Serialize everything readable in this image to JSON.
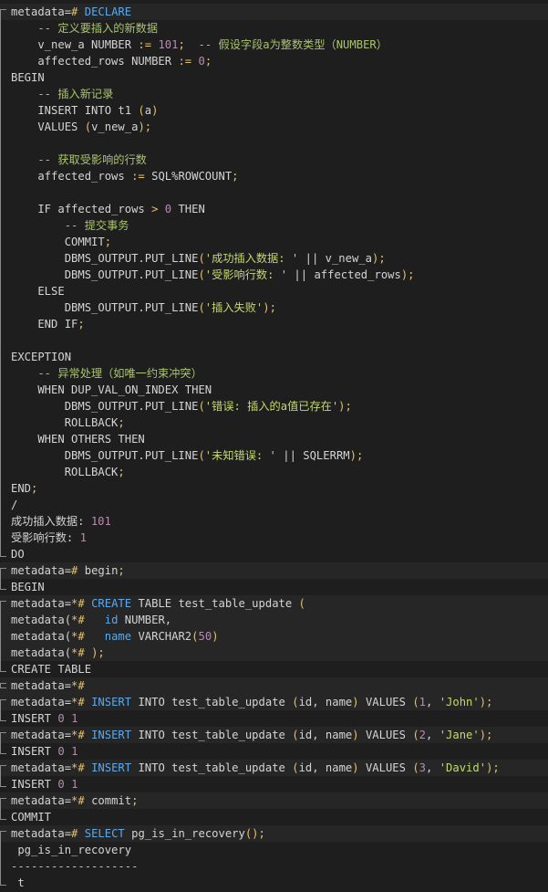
{
  "colors": {
    "background": "#1e1e1e",
    "highlight": "#262626",
    "text": "#d4d4d4",
    "number": "#b48ead",
    "string": "#c3d96d",
    "comment": "#a9c46b",
    "operator": "#e6c06a",
    "keyword": "#5fa8e8"
  },
  "lines": [
    {
      "hl": true,
      "segs": [
        [
          "plain",
          "metadata="
        ],
        [
          "op",
          "#"
        ],
        [
          "plain",
          " "
        ],
        [
          "kw2",
          "DECLARE"
        ]
      ]
    },
    {
      "segs": [
        [
          "com",
          "    -- 定义要插入的新数据"
        ]
      ]
    },
    {
      "segs": [
        [
          "plain",
          "    v_new_a NUMBER "
        ],
        [
          "op",
          ":="
        ],
        [
          "plain",
          " "
        ],
        [
          "num",
          "101"
        ],
        [
          "op",
          ";"
        ],
        [
          "plain",
          "  "
        ],
        [
          "com",
          "-- 假设字段a为整数类型（NUMBER）"
        ]
      ]
    },
    {
      "segs": [
        [
          "plain",
          "    affected_rows NUMBER "
        ],
        [
          "op",
          ":="
        ],
        [
          "plain",
          " "
        ],
        [
          "num",
          "0"
        ],
        [
          "op",
          ";"
        ]
      ]
    },
    {
      "segs": [
        [
          "plain",
          "BEGIN"
        ]
      ]
    },
    {
      "segs": [
        [
          "com",
          "    -- 插入新记录"
        ]
      ]
    },
    {
      "segs": [
        [
          "plain",
          "    INSERT INTO t1 "
        ],
        [
          "op",
          "("
        ],
        [
          "plain",
          "a"
        ],
        [
          "op",
          ")"
        ]
      ]
    },
    {
      "segs": [
        [
          "plain",
          "    VALUES "
        ],
        [
          "op",
          "("
        ],
        [
          "plain",
          "v_new_a"
        ],
        [
          "op",
          ");"
        ]
      ]
    },
    {
      "segs": [
        [
          "plain",
          ""
        ]
      ]
    },
    {
      "segs": [
        [
          "com",
          "    -- 获取受影响的行数"
        ]
      ]
    },
    {
      "segs": [
        [
          "plain",
          "    affected_rows "
        ],
        [
          "op",
          ":="
        ],
        [
          "plain",
          " SQL%ROWCOUNT"
        ],
        [
          "op",
          ";"
        ]
      ]
    },
    {
      "segs": [
        [
          "plain",
          ""
        ]
      ]
    },
    {
      "segs": [
        [
          "plain",
          "    IF affected_rows "
        ],
        [
          "op",
          ">"
        ],
        [
          "plain",
          " "
        ],
        [
          "num",
          "0"
        ],
        [
          "plain",
          " THEN"
        ]
      ]
    },
    {
      "segs": [
        [
          "com",
          "        -- 提交事务"
        ]
      ]
    },
    {
      "segs": [
        [
          "plain",
          "        COMMIT"
        ],
        [
          "op",
          ";"
        ]
      ]
    },
    {
      "segs": [
        [
          "plain",
          "        DBMS_OUTPUT.PUT_LINE"
        ],
        [
          "op",
          "("
        ],
        [
          "str",
          "'成功插入数据: '"
        ],
        [
          "plain",
          " || v_new_a"
        ],
        [
          "op",
          ");"
        ]
      ]
    },
    {
      "segs": [
        [
          "plain",
          "        DBMS_OUTPUT.PUT_LINE"
        ],
        [
          "op",
          "("
        ],
        [
          "str",
          "'受影响行数: '"
        ],
        [
          "plain",
          " || affected_rows"
        ],
        [
          "op",
          ");"
        ]
      ]
    },
    {
      "segs": [
        [
          "plain",
          "    ELSE"
        ]
      ]
    },
    {
      "segs": [
        [
          "plain",
          "        DBMS_OUTPUT.PUT_LINE"
        ],
        [
          "op",
          "("
        ],
        [
          "str",
          "'插入失败'"
        ],
        [
          "op",
          ");"
        ]
      ]
    },
    {
      "segs": [
        [
          "plain",
          "    END IF"
        ],
        [
          "op",
          ";"
        ]
      ]
    },
    {
      "segs": [
        [
          "plain",
          ""
        ]
      ]
    },
    {
      "segs": [
        [
          "plain",
          "EXCEPTION"
        ]
      ]
    },
    {
      "segs": [
        [
          "com",
          "    -- 异常处理（如唯一约束冲突）"
        ]
      ]
    },
    {
      "segs": [
        [
          "plain",
          "    WHEN DUP_VAL_ON_INDEX THEN"
        ]
      ]
    },
    {
      "segs": [
        [
          "plain",
          "        DBMS_OUTPUT.PUT_LINE"
        ],
        [
          "op",
          "("
        ],
        [
          "str",
          "'错误: 插入的a值已存在'"
        ],
        [
          "op",
          ");"
        ]
      ]
    },
    {
      "segs": [
        [
          "plain",
          "        ROLLBACK"
        ],
        [
          "op",
          ";"
        ]
      ]
    },
    {
      "segs": [
        [
          "plain",
          "    WHEN OTHERS THEN"
        ]
      ]
    },
    {
      "segs": [
        [
          "plain",
          "        DBMS_OUTPUT.PUT_LINE"
        ],
        [
          "op",
          "("
        ],
        [
          "str",
          "'未知错误: '"
        ],
        [
          "plain",
          " || SQLERRM"
        ],
        [
          "op",
          ");"
        ]
      ]
    },
    {
      "segs": [
        [
          "plain",
          "        ROLLBACK"
        ],
        [
          "op",
          ";"
        ]
      ]
    },
    {
      "segs": [
        [
          "plain",
          "END"
        ],
        [
          "op",
          ";"
        ]
      ]
    },
    {
      "segs": [
        [
          "plain",
          "/"
        ]
      ]
    },
    {
      "segs": [
        [
          "plain",
          "成功插入数据: "
        ],
        [
          "num",
          "101"
        ]
      ]
    },
    {
      "segs": [
        [
          "plain",
          "受影响行数: "
        ],
        [
          "num",
          "1"
        ]
      ]
    },
    {
      "segs": [
        [
          "plain",
          "DO"
        ]
      ]
    },
    {
      "hl": true,
      "segs": [
        [
          "plain",
          "metadata="
        ],
        [
          "op",
          "#"
        ],
        [
          "plain",
          " begin"
        ],
        [
          "op",
          ";"
        ]
      ]
    },
    {
      "segs": [
        [
          "plain",
          "BEGIN"
        ]
      ]
    },
    {
      "hl": true,
      "segs": [
        [
          "plain",
          "metadata="
        ],
        [
          "op",
          "*#"
        ],
        [
          "plain",
          " "
        ],
        [
          "kw2",
          "CREATE"
        ],
        [
          "plain",
          " TABLE test_table_update "
        ],
        [
          "op",
          "("
        ]
      ]
    },
    {
      "hl": true,
      "segs": [
        [
          "plain",
          "metadata("
        ],
        [
          "op",
          "*#"
        ],
        [
          "plain",
          "   "
        ],
        [
          "kw2",
          "id"
        ],
        [
          "plain",
          " NUMBER,"
        ]
      ]
    },
    {
      "hl": true,
      "segs": [
        [
          "plain",
          "metadata("
        ],
        [
          "op",
          "*#"
        ],
        [
          "plain",
          "   "
        ],
        [
          "kw2",
          "name"
        ],
        [
          "plain",
          " VARCHAR2"
        ],
        [
          "op",
          "("
        ],
        [
          "num",
          "50"
        ],
        [
          "op",
          ")"
        ]
      ]
    },
    {
      "hl": true,
      "segs": [
        [
          "plain",
          "metadata("
        ],
        [
          "op",
          "*#"
        ],
        [
          "plain",
          " "
        ],
        [
          "op",
          ");"
        ]
      ]
    },
    {
      "segs": [
        [
          "plain",
          "CREATE TABLE"
        ]
      ]
    },
    {
      "hl": true,
      "segs": [
        [
          "plain",
          "metadata="
        ],
        [
          "op",
          "*#"
        ]
      ]
    },
    {
      "hl": true,
      "segs": [
        [
          "plain",
          "metadata="
        ],
        [
          "op",
          "*#"
        ],
        [
          "plain",
          " "
        ],
        [
          "kw2",
          "INSERT"
        ],
        [
          "plain",
          " INTO test_table_update "
        ],
        [
          "op",
          "("
        ],
        [
          "plain",
          "id, name"
        ],
        [
          "op",
          ")"
        ],
        [
          "plain",
          " VALUES "
        ],
        [
          "op",
          "("
        ],
        [
          "num",
          "1"
        ],
        [
          "plain",
          ", "
        ],
        [
          "str",
          "'John'"
        ],
        [
          "op",
          ");"
        ]
      ]
    },
    {
      "segs": [
        [
          "plain",
          "INSERT "
        ],
        [
          "num",
          "0"
        ],
        [
          "plain",
          " "
        ],
        [
          "num",
          "1"
        ]
      ]
    },
    {
      "hl": true,
      "segs": [
        [
          "plain",
          "metadata="
        ],
        [
          "op",
          "*#"
        ],
        [
          "plain",
          " "
        ],
        [
          "kw2",
          "INSERT"
        ],
        [
          "plain",
          " INTO test_table_update "
        ],
        [
          "op",
          "("
        ],
        [
          "plain",
          "id, name"
        ],
        [
          "op",
          ")"
        ],
        [
          "plain",
          " VALUES "
        ],
        [
          "op",
          "("
        ],
        [
          "num",
          "2"
        ],
        [
          "plain",
          ", "
        ],
        [
          "str",
          "'Jane'"
        ],
        [
          "op",
          ");"
        ]
      ]
    },
    {
      "segs": [
        [
          "plain",
          "INSERT "
        ],
        [
          "num",
          "0"
        ],
        [
          "plain",
          " "
        ],
        [
          "num",
          "1"
        ]
      ]
    },
    {
      "hl": true,
      "segs": [
        [
          "plain",
          "metadata="
        ],
        [
          "op",
          "*#"
        ],
        [
          "plain",
          " "
        ],
        [
          "kw2",
          "INSERT"
        ],
        [
          "plain",
          " INTO test_table_update "
        ],
        [
          "op",
          "("
        ],
        [
          "plain",
          "id, name"
        ],
        [
          "op",
          ")"
        ],
        [
          "plain",
          " VALUES "
        ],
        [
          "op",
          "("
        ],
        [
          "num",
          "3"
        ],
        [
          "plain",
          ", "
        ],
        [
          "str",
          "'David'"
        ],
        [
          "op",
          ");"
        ]
      ]
    },
    {
      "segs": [
        [
          "plain",
          "INSERT "
        ],
        [
          "num",
          "0"
        ],
        [
          "plain",
          " "
        ],
        [
          "num",
          "1"
        ]
      ]
    },
    {
      "hl": true,
      "segs": [
        [
          "plain",
          "metadata="
        ],
        [
          "op",
          "*#"
        ],
        [
          "plain",
          " commit"
        ],
        [
          "op",
          ";"
        ]
      ]
    },
    {
      "segs": [
        [
          "plain",
          "COMMIT"
        ]
      ]
    },
    {
      "hl": true,
      "segs": [
        [
          "plain",
          "metadata="
        ],
        [
          "op",
          "#"
        ],
        [
          "plain",
          " "
        ],
        [
          "kw2",
          "SELECT"
        ],
        [
          "plain",
          " pg_is_in_recovery"
        ],
        [
          "op",
          "();"
        ]
      ]
    },
    {
      "segs": [
        [
          "plain",
          " pg_is_in_recovery"
        ]
      ]
    },
    {
      "segs": [
        [
          "op",
          "-------------------"
        ]
      ]
    },
    {
      "segs": [
        [
          "plain",
          " t"
        ]
      ]
    }
  ]
}
